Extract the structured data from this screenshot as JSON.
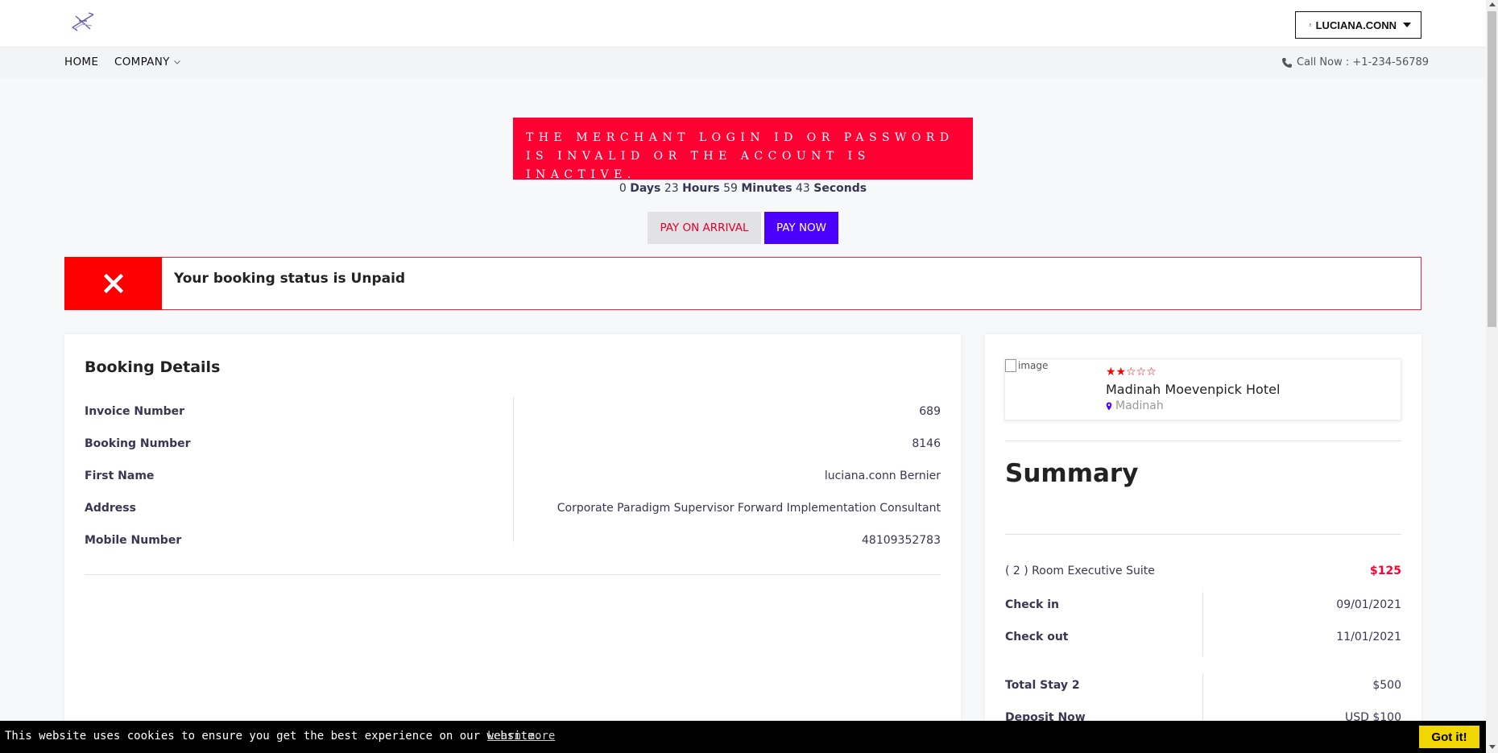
{
  "header": {
    "logo_icon": "plane-logo-icon",
    "user_label": "LUCIANA.CONN"
  },
  "nav": {
    "home": "HOME",
    "company": "COMPANY",
    "call": "Call Now : +1-234-56789"
  },
  "alert": {
    "error_message": "THE MERCHANT LOGIN ID OR PASSWORD IS INVALID OR THE ACCOUNT IS INACTIVE."
  },
  "countdown": {
    "days": "0",
    "days_label": "Days",
    "hours": "23",
    "hours_label": "Hours",
    "minutes": "59",
    "minutes_label": "Minutes",
    "seconds": "43",
    "seconds_label": "Seconds"
  },
  "payment": {
    "pay_on_arrival": "PAY ON ARRIVAL",
    "pay_now": "PAY NOW"
  },
  "status": {
    "text": "Your booking status is Unpaid"
  },
  "booking": {
    "title": "Booking Details",
    "rows": [
      {
        "label": "Invoice Number",
        "value": "689"
      },
      {
        "label": "Booking Number",
        "value": "8146"
      },
      {
        "label": "First Name",
        "value": "luciana.conn Bernier"
      },
      {
        "label": "Address",
        "value": "Corporate Paradigm Supervisor Forward Implementation Consultant"
      },
      {
        "label": "Mobile Number",
        "value": "48109352783"
      }
    ]
  },
  "hotel": {
    "image_alt": "image",
    "stars_rating": 2,
    "stars_max": 5,
    "stars_text": "★★☆☆☆",
    "name": "Madinah Moevenpick Hotel",
    "location": "Madinah"
  },
  "summary": {
    "title": "Summary",
    "room_label": "( 2 ) Room Executive Suite",
    "room_price": "$125",
    "check_in_label": "Check in",
    "check_in_value": "09/01/2021",
    "check_out_label": "Check out",
    "check_out_value": "11/01/2021",
    "total_stay_label": "Total Stay 2",
    "total_stay_value": "$500",
    "deposit_label": "Deposit Now",
    "deposit_value": "USD $100"
  },
  "cookie": {
    "text": "This website uses cookies to ensure you get the best experience on our website.",
    "link": "Learn more",
    "button": "Got it!"
  },
  "colors": {
    "error_red": "#ff0033",
    "pay_now_purple": "#4c00ff",
    "star_red": "#ff0000",
    "cookie_button_yellow": "#f1d600"
  }
}
